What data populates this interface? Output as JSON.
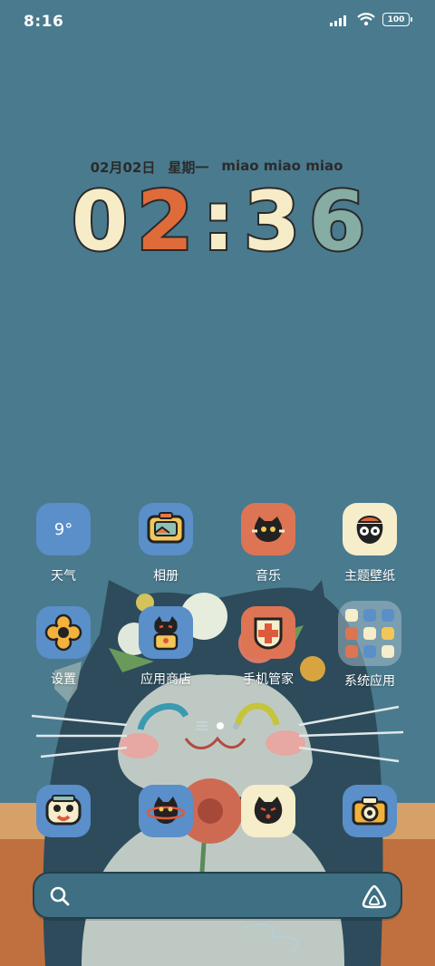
{
  "status_bar": {
    "time": "8:16",
    "battery": "100"
  },
  "clock_widget": {
    "date": "02月02日",
    "weekday": "星期一",
    "tagline": "miao miao miao",
    "hour_1": "0",
    "hour_2": "2",
    "colon": ":",
    "minute_1": "3",
    "minute_2": "6"
  },
  "apps": {
    "weather": {
      "label": "天气",
      "temp": "9°"
    },
    "gallery": {
      "label": "相册"
    },
    "music": {
      "label": "音乐"
    },
    "themes": {
      "label": "主题壁纸"
    },
    "settings": {
      "label": "设置"
    },
    "app_store": {
      "label": "应用商店"
    },
    "security": {
      "label": "手机管家"
    },
    "system_apps": {
      "label": "系统应用"
    }
  },
  "colors": {
    "background": "#4a7a8e",
    "digit_cream": "#f7ecc8",
    "digit_orange": "#e06b3a",
    "digit_teal": "#85ada3",
    "icon_blue": "#5a8fc9",
    "icon_orange": "#dd7454",
    "icon_cream": "#f6edca"
  },
  "page_indicator": {
    "count": 2,
    "active": 1
  },
  "search": {
    "search_icon": "search-icon",
    "assistant_icon": "assistant-icon"
  }
}
